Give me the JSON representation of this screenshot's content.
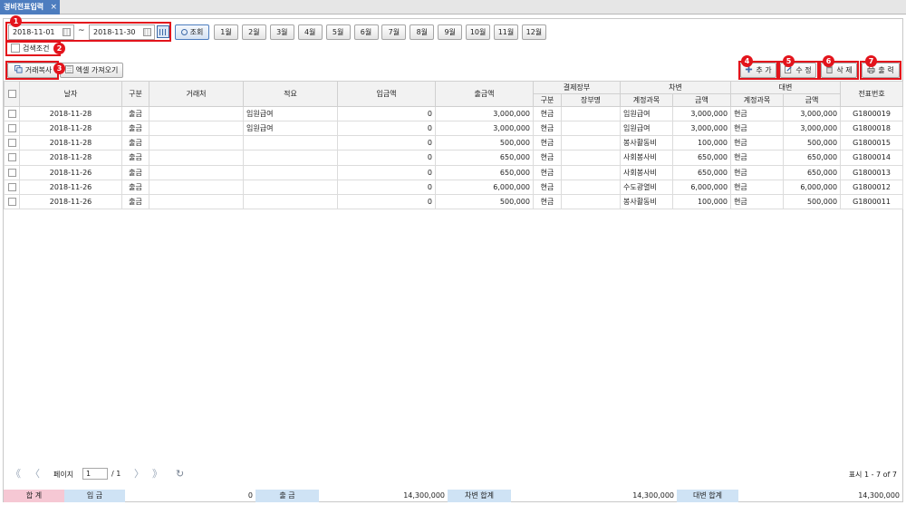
{
  "tab": {
    "title": "경비전표입력",
    "close": "×"
  },
  "search": {
    "date_from": "2018-11-01",
    "date_to": "2018-11-30",
    "separator": "~",
    "search_button": "조회",
    "months": [
      "1월",
      "2월",
      "3월",
      "4월",
      "5월",
      "6월",
      "7월",
      "8월",
      "9월",
      "10월",
      "11월",
      "12월"
    ],
    "condition_label": "검색조건"
  },
  "toolbar": {
    "copy_label": "거래복사",
    "excel_label": "엑셀 가져오기",
    "add_label": "추 가",
    "edit_label": "수 정",
    "delete_label": "삭 제",
    "print_label": "출 력"
  },
  "badges": [
    "1",
    "2",
    "3",
    "4",
    "5",
    "6",
    "7"
  ],
  "grid": {
    "headers": {
      "date": "날자",
      "type": "구분",
      "client": "거래처",
      "summary": "적요",
      "income": "입금액",
      "expense": "출금액",
      "payment": "결제장부",
      "payment_type": "구분",
      "payment_book": "장부명",
      "debit": "차변",
      "debit_account": "계정과목",
      "debit_amount": "금액",
      "credit": "대변",
      "credit_account": "계정과목",
      "credit_amount": "금액",
      "voucher": "전표번호"
    },
    "rows": [
      {
        "date": "2018-11-28",
        "type": "출금",
        "client": "",
        "summary": "임원급여",
        "income": "0",
        "expense": "3,000,000",
        "ptype": "현금",
        "pbook": "",
        "dacc": "임원급여",
        "damt": "3,000,000",
        "cacc": "현금",
        "camt": "3,000,000",
        "no": "G1800019"
      },
      {
        "date": "2018-11-28",
        "type": "출금",
        "client": "",
        "summary": "임원급여",
        "income": "0",
        "expense": "3,000,000",
        "ptype": "현금",
        "pbook": "",
        "dacc": "임원급여",
        "damt": "3,000,000",
        "cacc": "현금",
        "camt": "3,000,000",
        "no": "G1800018"
      },
      {
        "date": "2018-11-28",
        "type": "출금",
        "client": "",
        "summary": "",
        "income": "0",
        "expense": "500,000",
        "ptype": "현금",
        "pbook": "",
        "dacc": "봉사활동비",
        "damt": "100,000",
        "cacc": "현금",
        "camt": "500,000",
        "no": "G1800015"
      },
      {
        "date": "2018-11-28",
        "type": "출금",
        "client": "",
        "summary": "",
        "income": "0",
        "expense": "650,000",
        "ptype": "현금",
        "pbook": "",
        "dacc": "사회봉사비",
        "damt": "650,000",
        "cacc": "현금",
        "camt": "650,000",
        "no": "G1800014"
      },
      {
        "date": "2018-11-26",
        "type": "출금",
        "client": "",
        "summary": "",
        "income": "0",
        "expense": "650,000",
        "ptype": "현금",
        "pbook": "",
        "dacc": "사회봉사비",
        "damt": "650,000",
        "cacc": "현금",
        "camt": "650,000",
        "no": "G1800013"
      },
      {
        "date": "2018-11-26",
        "type": "출금",
        "client": "",
        "summary": "",
        "income": "0",
        "expense": "6,000,000",
        "ptype": "현금",
        "pbook": "",
        "dacc": "수도광열비",
        "damt": "6,000,000",
        "cacc": "현금",
        "camt": "6,000,000",
        "no": "G1800012"
      },
      {
        "date": "2018-11-26",
        "type": "출금",
        "client": "",
        "summary": "",
        "income": "0",
        "expense": "500,000",
        "ptype": "현금",
        "pbook": "",
        "dacc": "봉사활동비",
        "damt": "100,000",
        "cacc": "현금",
        "camt": "500,000",
        "no": "G1800011"
      }
    ]
  },
  "pager": {
    "first": "《",
    "prev": "〈",
    "page_label": "페이지",
    "page_value": "1",
    "total": "/ 1",
    "next": "〉",
    "last": "》",
    "refresh": "↻",
    "status": "표시 1 - 7 of 7"
  },
  "summary": {
    "total_label": "합 계",
    "income_label": "입 금",
    "income_value": "0",
    "expense_label": "출 금",
    "expense_value": "14,300,000",
    "debit_label": "차변 합계",
    "debit_value": "14,300,000",
    "credit_label": "대변 합계",
    "credit_value": "14,300,000"
  },
  "colors": {
    "accent": "#4d7dbf",
    "highlight": "#e3141c",
    "sum_pink": "#f6c8d4",
    "sum_blue": "#cfe3f5"
  }
}
